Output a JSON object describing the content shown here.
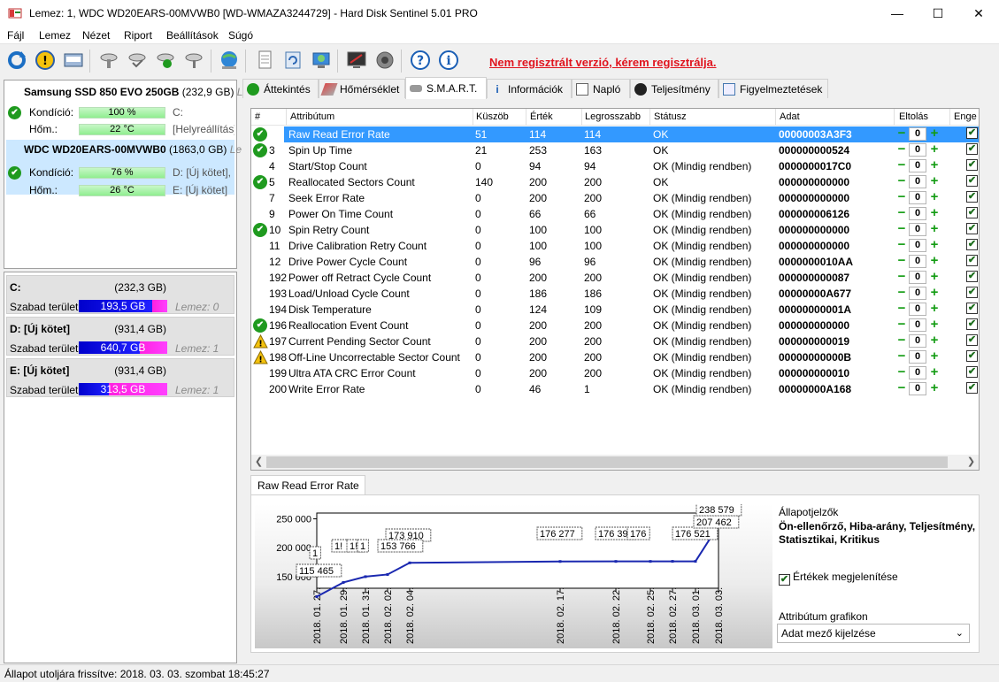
{
  "window": {
    "title": "Lemez: 1, WDC WD20EARS-00MVWB0 [WD-WMAZA3244729]  -  Hard Disk Sentinel 5.01 PRO",
    "minimize": "—",
    "maximize": "☐",
    "close": "✕"
  },
  "menu": [
    "Fájl",
    "Lemez",
    "Nézet",
    "Riport",
    "Beállítások",
    "Súgó"
  ],
  "toolbar": {
    "register_link": "Nem regisztrált verzió, kérem regisztrálja.",
    "icons": [
      "refresh-icon",
      "warning-icon",
      "disk-icon",
      "disk-settings-icon",
      "disk-check-icon",
      "disk-ok-icon",
      "disk-tools-icon",
      "network-icon",
      "report-icon",
      "update-icon",
      "web-icon",
      "monitor-icon",
      "speaker-icon",
      "help-icon",
      "info-icon"
    ]
  },
  "disks": [
    {
      "name": "Samsung SSD 850 EVO 250GB",
      "size": "(232,9 GB)",
      "extra": "Le",
      "cond_label": "Kondíció:",
      "cond": "100 %",
      "cond_extra": "C:",
      "temp_label": "Hőm.:",
      "temp": "22 °C",
      "temp_extra": "[Helyreállítás]"
    },
    {
      "name": "WDC WD20EARS-00MVWB0",
      "size": "(1863,0 GB)",
      "extra": "Le",
      "cond_label": "Kondíció:",
      "cond": "76 %",
      "cond_extra": "D: [Új kötet],",
      "temp_label": "Hőm.:",
      "temp": "26 °C",
      "temp_extra": "E: [Új kötet]"
    }
  ],
  "partitions": [
    {
      "name": "C:",
      "size": "(232,3 GB)",
      "free_label": "Szabad terület",
      "free": "193,5 GB",
      "free_fraction": 0.83,
      "disk": "Lemez: 0"
    },
    {
      "name": "D: [Új kötet]",
      "size": "(931,4 GB)",
      "free_label": "Szabad terület",
      "free": "640,7 GB",
      "free_fraction": 0.69,
      "disk": "Lemez: 1"
    },
    {
      "name": "E: [Új kötet]",
      "size": "(931,4 GB)",
      "free_label": "Szabad terület",
      "free": "313,5 GB",
      "free_fraction": 0.34,
      "disk": "Lemez: 1"
    }
  ],
  "tabs": [
    "Áttekintés",
    "Hőmérséklet",
    "S.M.A.R.T.",
    "Információk",
    "Napló",
    "Teljesítmény",
    "Figyelmeztetések"
  ],
  "smart": {
    "headers": [
      "#",
      "Attribútum",
      "Küszöb",
      "Érték",
      "Legrosszabb",
      "Státusz",
      "Adat",
      "Eltolás",
      "Enge"
    ],
    "rows": [
      {
        "id": "1",
        "name": "Raw Read Error Rate",
        "thr": "51",
        "val": "114",
        "worst": "114",
        "status": "OK",
        "data": "00000003A3F3",
        "off": "0",
        "icon": "ok"
      },
      {
        "id": "3",
        "name": "Spin Up Time",
        "thr": "21",
        "val": "253",
        "worst": "163",
        "status": "OK",
        "data": "000000000524",
        "off": "0",
        "icon": "ok"
      },
      {
        "id": "4",
        "name": "Start/Stop Count",
        "thr": "0",
        "val": "94",
        "worst": "94",
        "status": "OK (Mindig rendben)",
        "data": "0000000017C0",
        "off": "0",
        "icon": ""
      },
      {
        "id": "5",
        "name": "Reallocated Sectors Count",
        "thr": "140",
        "val": "200",
        "worst": "200",
        "status": "OK",
        "data": "000000000000",
        "off": "0",
        "icon": "ok"
      },
      {
        "id": "7",
        "name": "Seek Error Rate",
        "thr": "0",
        "val": "200",
        "worst": "200",
        "status": "OK (Mindig rendben)",
        "data": "000000000000",
        "off": "0",
        "icon": ""
      },
      {
        "id": "9",
        "name": "Power On Time Count",
        "thr": "0",
        "val": "66",
        "worst": "66",
        "status": "OK (Mindig rendben)",
        "data": "000000006126",
        "off": "0",
        "icon": ""
      },
      {
        "id": "10",
        "name": "Spin Retry Count",
        "thr": "0",
        "val": "100",
        "worst": "100",
        "status": "OK (Mindig rendben)",
        "data": "000000000000",
        "off": "0",
        "icon": "ok"
      },
      {
        "id": "11",
        "name": "Drive Calibration Retry Count",
        "thr": "0",
        "val": "100",
        "worst": "100",
        "status": "OK (Mindig rendben)",
        "data": "000000000000",
        "off": "0",
        "icon": ""
      },
      {
        "id": "12",
        "name": "Drive Power Cycle Count",
        "thr": "0",
        "val": "96",
        "worst": "96",
        "status": "OK (Mindig rendben)",
        "data": "0000000010AA",
        "off": "0",
        "icon": ""
      },
      {
        "id": "192",
        "name": "Power off Retract Cycle Count",
        "thr": "0",
        "val": "200",
        "worst": "200",
        "status": "OK (Mindig rendben)",
        "data": "000000000087",
        "off": "0",
        "icon": ""
      },
      {
        "id": "193",
        "name": "Load/Unload Cycle Count",
        "thr": "0",
        "val": "186",
        "worst": "186",
        "status": "OK (Mindig rendben)",
        "data": "00000000A677",
        "off": "0",
        "icon": ""
      },
      {
        "id": "194",
        "name": "Disk Temperature",
        "thr": "0",
        "val": "124",
        "worst": "109",
        "status": "OK (Mindig rendben)",
        "data": "00000000001A",
        "off": "0",
        "icon": ""
      },
      {
        "id": "196",
        "name": "Reallocation Event Count",
        "thr": "0",
        "val": "200",
        "worst": "200",
        "status": "OK (Mindig rendben)",
        "data": "000000000000",
        "off": "0",
        "icon": "ok"
      },
      {
        "id": "197",
        "name": "Current Pending Sector Count",
        "thr": "0",
        "val": "200",
        "worst": "200",
        "status": "OK (Mindig rendben)",
        "data": "000000000019",
        "off": "0",
        "icon": "warn"
      },
      {
        "id": "198",
        "name": "Off-Line Uncorrectable Sector Count",
        "thr": "0",
        "val": "200",
        "worst": "200",
        "status": "OK (Mindig rendben)",
        "data": "00000000000B",
        "off": "0",
        "icon": "warn"
      },
      {
        "id": "199",
        "name": "Ultra ATA CRC Error Count",
        "thr": "0",
        "val": "200",
        "worst": "200",
        "status": "OK (Mindig rendben)",
        "data": "000000000010",
        "off": "0",
        "icon": ""
      },
      {
        "id": "200",
        "name": "Write Error Rate",
        "thr": "0",
        "val": "46",
        "worst": "1",
        "status": "OK (Mindig rendben)",
        "data": "00000000A168",
        "off": "0",
        "icon": ""
      }
    ]
  },
  "chart_tab": "Raw Read Error Rate",
  "chart_data": {
    "type": "line",
    "title": "",
    "xlabel": "",
    "ylabel": "",
    "y_ticks": [
      "250 000",
      "200 000",
      "150 000"
    ],
    "ylim": [
      130000,
      260000
    ],
    "x": [
      "2018. 01. 27.",
      "2018. 01. 29.",
      "2018. 01. 31.",
      "2018. 02. 02.",
      "2018. 02. 04.",
      "2018. 02. 17.",
      "2018. 02. 22.",
      "2018. 02. 25.",
      "2018. 02. 27.",
      "2018. 03. 01.",
      "2018. 03. 03."
    ],
    "series": [
      {
        "values": [
          115465,
          140000,
          150000,
          153766,
          173910,
          176277,
          176390,
          176400,
          176500,
          176521,
          238579
        ],
        "labels": [
          "115 465",
          "1",
          "1!",
          "1!",
          "1",
          "173 910",
          "176 277",
          "176 39",
          "176",
          "176 521",
          "207 462",
          "238 579",
          "153 766"
        ]
      }
    ],
    "color": "#1a28b0",
    "grid": false
  },
  "side": {
    "status_title": "Állapotjelzők",
    "status_value": "Ön-ellenőrző, Hiba-arány, Teljesítmény, Statisztikai, Kritikus",
    "show_values": "Értékek megjelenítése",
    "attr_graph_label": "Attribútum grafikon",
    "attr_graph_value": "Adat mező kijelzése"
  },
  "status_bar": "Állapot utoljára frissítve: 2018. 03. 03. szombat 18:45:27"
}
